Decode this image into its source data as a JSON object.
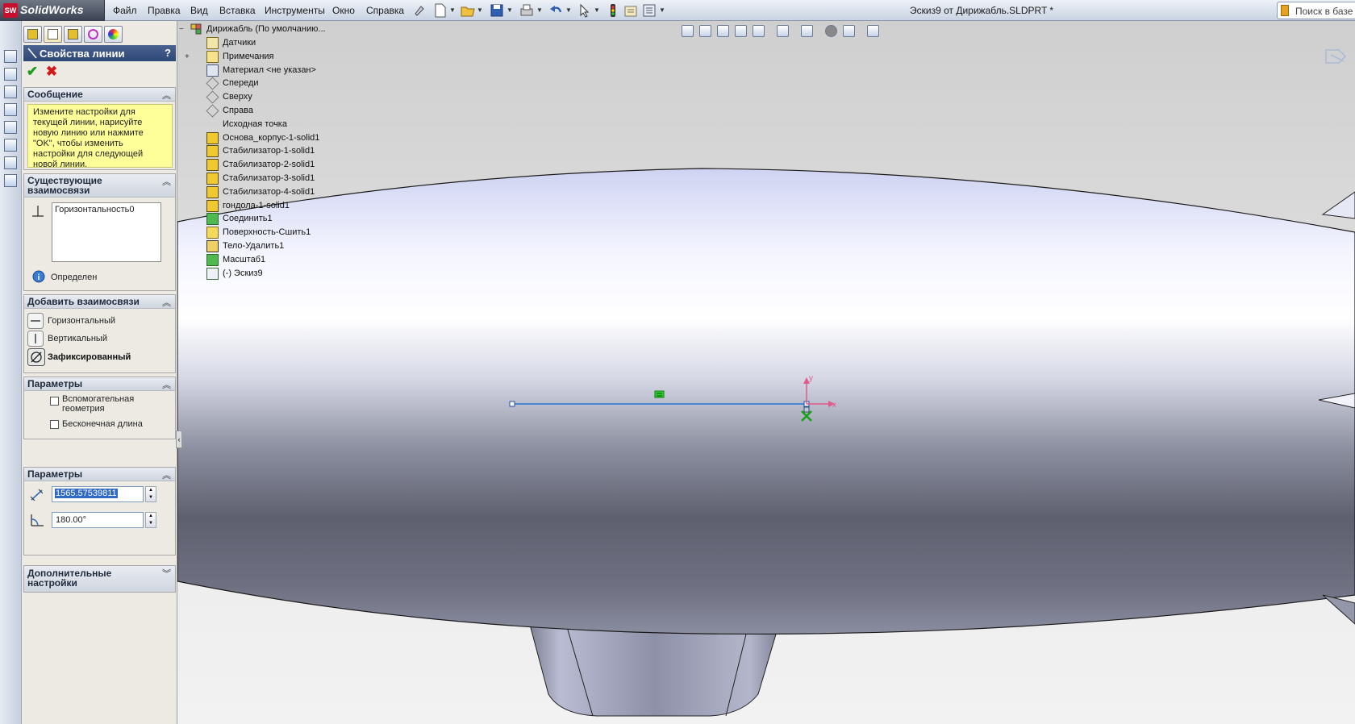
{
  "app": {
    "logo_badge": "SW",
    "name": "SolidWorks",
    "doc_title": "Эскиз9 от Дирижабль.SLDPRT *"
  },
  "menu": [
    "Файл",
    "Правка",
    "Вид",
    "Вставка",
    "Инструменты",
    "Окно",
    "Справка"
  ],
  "search": {
    "placeholder": "Поиск в базе з"
  },
  "panel": {
    "title": "Свойства линии",
    "help": "?",
    "message_group": {
      "title": "Сообщение",
      "text": "Измените настройки для текущей линии, нарисуйте новую линию или нажмите \"OK\", чтобы изменить настройки для следующей новой линии."
    },
    "existing_relations": {
      "title": "Существующие взаимосвязи",
      "items": [
        "Горизонтальность0"
      ],
      "status": "Определен"
    },
    "add_relations": {
      "title": "Добавить взаимосвязи",
      "items": [
        "Горизонтальный",
        "Вертикальный",
        "Зафиксированный"
      ]
    },
    "options": {
      "title": "Параметры",
      "construction": "Вспомогательная геометрия",
      "infinite": "Бесконечная длина"
    },
    "parameters": {
      "title": "Параметры",
      "length": "1565.57539811",
      "angle": "180.00°"
    },
    "additional": {
      "title": "Дополнительные настройки"
    }
  },
  "tree": {
    "root": "Дирижабль  (По умолчанию...",
    "items": [
      "Датчики",
      "Примечания",
      "Материал <не указан>",
      "Спереди",
      "Сверху",
      "Справа",
      "Исходная точка",
      "Основа_корпус-1-solid1",
      "Стабилизатор-1-solid1",
      "Стабилизатор-2-solid1",
      "Стабилизатор-3-solid1",
      "Стабилизатор-4-solid1",
      "гондола-1-solid1",
      "Соединить1",
      "Поверхность-Сшить1",
      "Тело-Удалить1",
      "Масштаб1",
      "(-) Эскиз9"
    ]
  },
  "sketch": {
    "axis_x": "x",
    "axis_y": "y"
  },
  "colors": {
    "panel_header": "#2d4776",
    "message_bg": "#ffff99",
    "sketch_line": "#3a7fd5"
  }
}
